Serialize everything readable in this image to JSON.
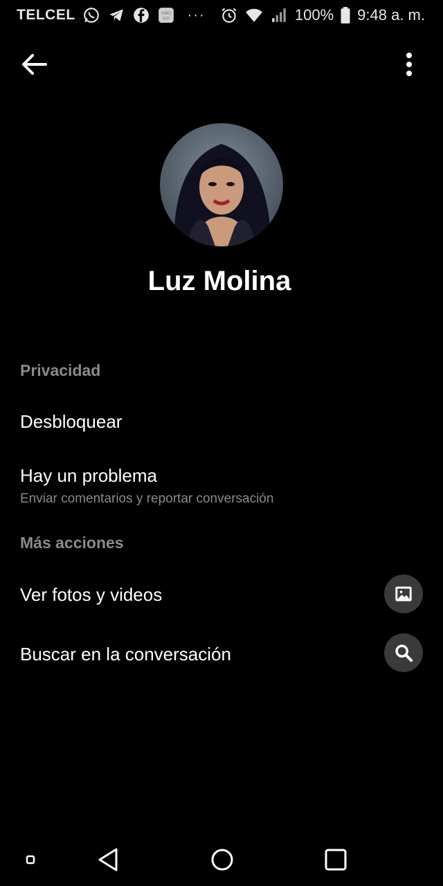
{
  "status_bar": {
    "carrier": "TELCEL",
    "notification_icons": [
      "whatsapp-icon",
      "telegram-icon",
      "facebook-icon",
      "hbo-go-icon"
    ],
    "overflow_dots": "···",
    "status_icons": [
      "alarm-icon",
      "wifi-icon",
      "signal-icon",
      "battery-icon"
    ],
    "battery_percent": "100%",
    "time": "9:48 a. m."
  },
  "app_bar": {
    "back_icon": "arrow-left-icon",
    "menu_icon": "more-vertical-icon"
  },
  "profile": {
    "name": "Luz Molina",
    "avatar_icon": "profile-photo"
  },
  "sections": {
    "privacy": {
      "header": "Privacidad",
      "unblock": "Desbloquear",
      "problem_title": "Hay un problema",
      "problem_subtitle": "Enviar comentarios y reportar conversación"
    },
    "more_actions": {
      "header": "Más acciones",
      "media_label": "Ver fotos y videos",
      "media_icon": "photo-icon",
      "search_label": "Buscar en la conversación",
      "search_icon": "search-icon"
    }
  },
  "nav_bar": {
    "icons": [
      "small-square-icon",
      "back-triangle-icon",
      "home-circle-icon",
      "recents-square-icon"
    ]
  },
  "colors": {
    "background": "#000000",
    "text_primary": "#ffffff",
    "text_secondary": "#8a8a8a",
    "icon_circle_bg": "#3a3a3a"
  }
}
